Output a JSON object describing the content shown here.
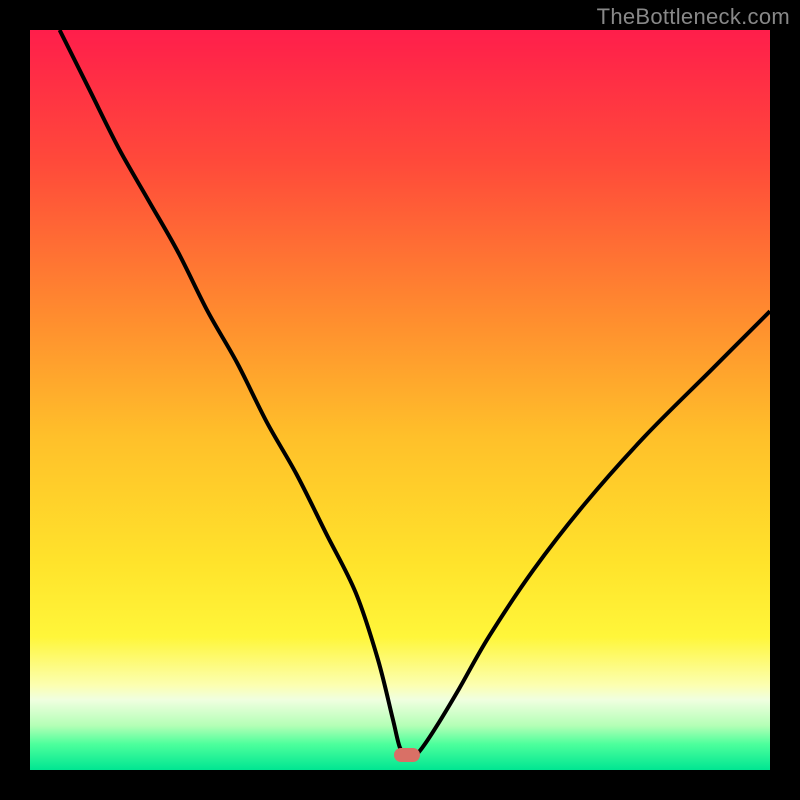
{
  "watermark": "TheBottleneck.com",
  "colors": {
    "frame": "#000000",
    "watermark": "#888888",
    "curve": "#000000",
    "marker": "#d97066",
    "gradient_stops": [
      {
        "offset": 0.0,
        "color": "#ff1e4b"
      },
      {
        "offset": 0.18,
        "color": "#ff4a3a"
      },
      {
        "offset": 0.38,
        "color": "#ff8a2f"
      },
      {
        "offset": 0.55,
        "color": "#ffc02a"
      },
      {
        "offset": 0.72,
        "color": "#ffe32b"
      },
      {
        "offset": 0.82,
        "color": "#fff63a"
      },
      {
        "offset": 0.885,
        "color": "#fcffb0"
      },
      {
        "offset": 0.905,
        "color": "#f0ffe0"
      },
      {
        "offset": 0.94,
        "color": "#b4ffb6"
      },
      {
        "offset": 0.965,
        "color": "#4dff9c"
      },
      {
        "offset": 1.0,
        "color": "#00e692"
      }
    ]
  },
  "chart_data": {
    "type": "line",
    "title": "",
    "xlabel": "",
    "ylabel": "",
    "xlim": [
      0,
      100
    ],
    "ylim": [
      0,
      100
    ],
    "grid": false,
    "legend": null,
    "note": "Bottleneck-style V curve. y ≈ 100 is top (high bottleneck / red), y ≈ 0 is bottom (optimal / green). Minimum at x ≈ 51.",
    "series": [
      {
        "name": "bottleneck-curve",
        "x": [
          4,
          8,
          12,
          16,
          20,
          24,
          28,
          32,
          36,
          40,
          44,
          47,
          49,
          50,
          51,
          52,
          53,
          55,
          58,
          62,
          68,
          75,
          83,
          92,
          100
        ],
        "y": [
          100,
          92,
          84,
          77,
          70,
          62,
          55,
          47,
          40,
          32,
          24,
          15,
          7,
          3,
          2,
          2,
          3,
          6,
          11,
          18,
          27,
          36,
          45,
          54,
          62
        ]
      }
    ],
    "marker": {
      "x": 51,
      "y": 2,
      "shape": "rounded-rect",
      "color": "#d97066"
    }
  }
}
